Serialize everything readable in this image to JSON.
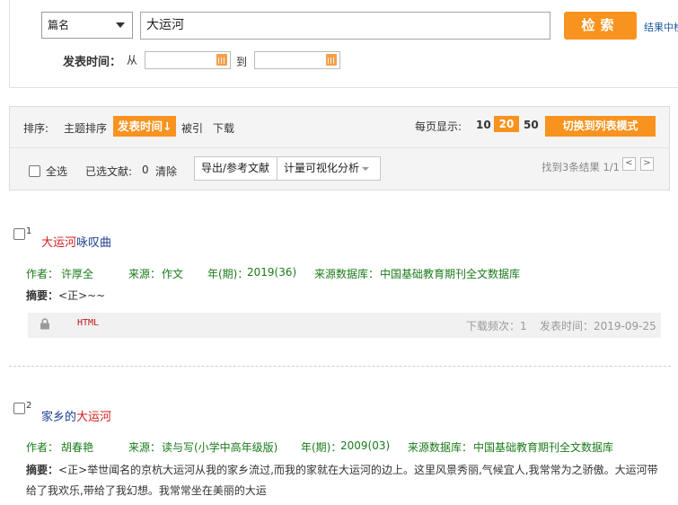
{
  "search": {
    "field": "篇名",
    "query": "大运河",
    "button": "检索",
    "in_result": "结果中检",
    "pub_time_label": "发表时间：",
    "from": "从",
    "to": "到"
  },
  "sort": {
    "label": "排序:",
    "items": [
      "主题排序",
      "发表时间↓",
      "被引",
      "下载"
    ],
    "active_index": 1
  },
  "per_page": {
    "label": "每页显示:",
    "options": [
      "10",
      "20",
      "50"
    ],
    "active": "20"
  },
  "switch_label": "切换到列表模式",
  "selection": {
    "select_all": "全选",
    "selected_label": "已选文献:",
    "selected_count": "0",
    "clear": "清除",
    "export": "导出/参考文献",
    "visual": "计量可视化分析"
  },
  "found_text": "找到3条结果  1/1",
  "pager": {
    "prev": "<",
    "next": ">"
  },
  "results": [
    {
      "num": "1",
      "title_hl": "大运河",
      "title_rest": "咏叹曲",
      "author_label": "作者：",
      "author": "许厚全",
      "source_label": "来源：",
      "source": "作文",
      "year_label": "年(期)：",
      "year": "2019(36)",
      "db_label": "来源数据库：",
      "db": "中国基础教育期刊全文数据库",
      "abstract_label": "摘要：",
      "abstract": "<正>~~",
      "html": "HTML",
      "downloads_label": "下载频次：",
      "downloads": "1",
      "pubdate_label": "发表时间：",
      "pubdate": "2019-09-25"
    },
    {
      "num": "2",
      "title_pre": "家乡的",
      "title_hl": "大运河",
      "author_label": "作者：",
      "author": "胡春艳",
      "source_label": "来源：",
      "source": "读与写(小学中高年级版)",
      "year_label": "年(期)：",
      "year": "2009(03)",
      "db_label": "来源数据库：",
      "db": "中国基础教育期刊全文数据库",
      "abstract_label": "摘要：",
      "abstract_line1": "<正>举世闻名的京杭大运河从我的家乡流过,而我的家就在大运河的边上。这里风景秀丽,气候宜人,我常常为之骄傲。大运河带",
      "abstract_line2": "给了我欢乐,带给了我幻想。我常常坐在美丽的大运"
    }
  ],
  "colors": {
    "accent": "#f7931e",
    "highlight": "#d01e1e",
    "title": "#1a3f91",
    "meta": "#1b7b1b"
  }
}
